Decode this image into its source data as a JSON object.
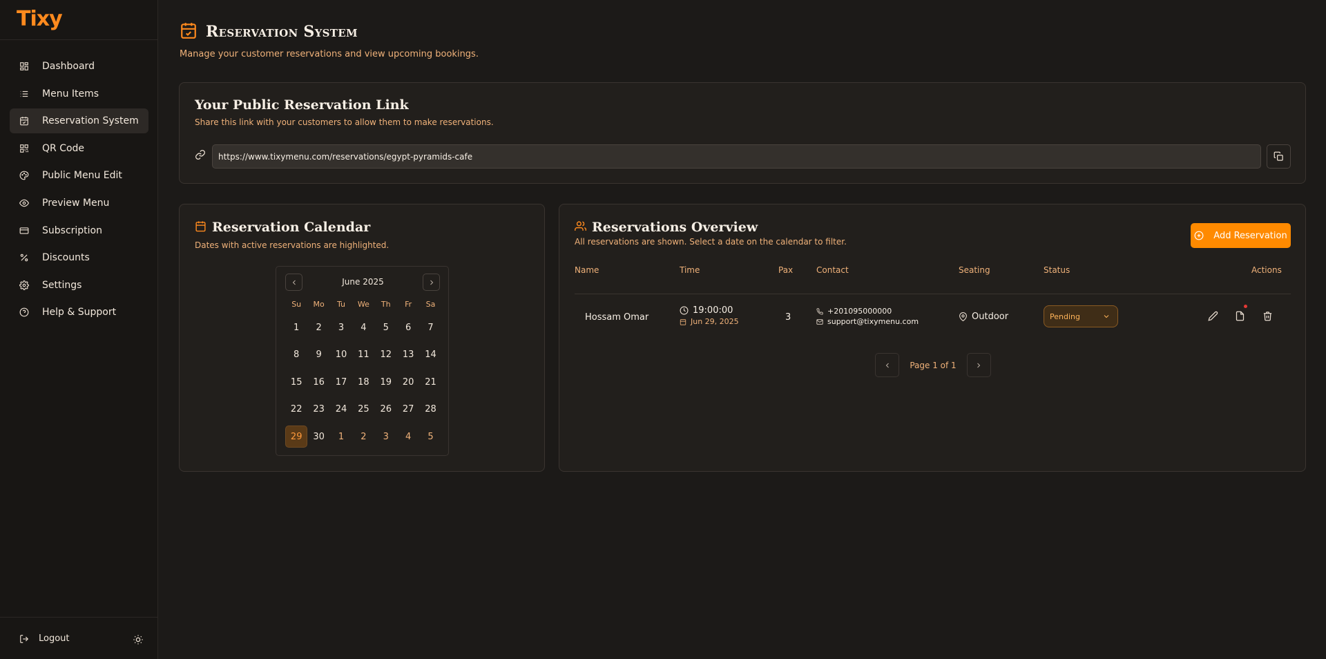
{
  "sidebar": {
    "logo": "Tixy",
    "items": [
      {
        "label": "Dashboard",
        "icon": "dashboard-icon"
      },
      {
        "label": "Menu Items",
        "icon": "list-icon"
      },
      {
        "label": "Reservation System",
        "icon": "calendar-check-icon",
        "active": true
      },
      {
        "label": "QR Code",
        "icon": "qr-code-icon"
      },
      {
        "label": "Public Menu Edit",
        "icon": "palette-icon"
      },
      {
        "label": "Preview Menu",
        "icon": "eye-icon"
      },
      {
        "label": "Subscription",
        "icon": "credit-card-icon"
      },
      {
        "label": "Discounts",
        "icon": "percent-icon"
      },
      {
        "label": "Settings",
        "icon": "gear-icon"
      },
      {
        "label": "Help & Support",
        "icon": "help-circle-icon"
      }
    ],
    "logout_label": "Logout"
  },
  "header": {
    "title": "Reservation System",
    "subtitle": "Manage your customer reservations and view upcoming bookings."
  },
  "public_link": {
    "title": "Your Public Reservation Link",
    "subtitle": "Share this link with your customers to allow them to make reservations.",
    "url": "https://www.tixymenu.com/reservations/egypt-pyramids-cafe"
  },
  "calendar": {
    "title": "Reservation Calendar",
    "subtitle": "Dates with active reservations are highlighted.",
    "month_label": "June 2025",
    "weekdays": [
      "Su",
      "Mo",
      "Tu",
      "We",
      "Th",
      "Fr",
      "Sa"
    ],
    "days": [
      "1",
      "2",
      "3",
      "4",
      "5",
      "6",
      "7",
      "8",
      "9",
      "10",
      "11",
      "12",
      "13",
      "14",
      "15",
      "16",
      "17",
      "18",
      "19",
      "20",
      "21",
      "22",
      "23",
      "24",
      "25",
      "26",
      "27",
      "28",
      "29",
      "30",
      "1",
      "2",
      "3",
      "4",
      "5"
    ],
    "selected_index": 28,
    "outside_from_index": 30
  },
  "reservations": {
    "title": "Reservations Overview",
    "subtitle": "All reservations are shown. Select a date on the calendar to filter.",
    "add_label": "Add Reservation",
    "columns": {
      "name": "Name",
      "time": "Time",
      "pax": "Pax",
      "contact": "Contact",
      "seating": "Seating",
      "status": "Status",
      "actions": "Actions"
    },
    "rows": [
      {
        "name": "Hossam Omar",
        "time": "19:00:00",
        "date": "Jun 29, 2025",
        "pax": "3",
        "phone": "+201095000000",
        "email": "support@tixymenu.com",
        "seating": "Outdoor",
        "status": "Pending"
      }
    ],
    "pager": "Page 1 of 1"
  },
  "colors": {
    "accent": "#ff8a00",
    "background": "#1c1a18",
    "card": "#221f1c",
    "muted_text": "#f0b27a",
    "notification_dot": "#e53935"
  }
}
